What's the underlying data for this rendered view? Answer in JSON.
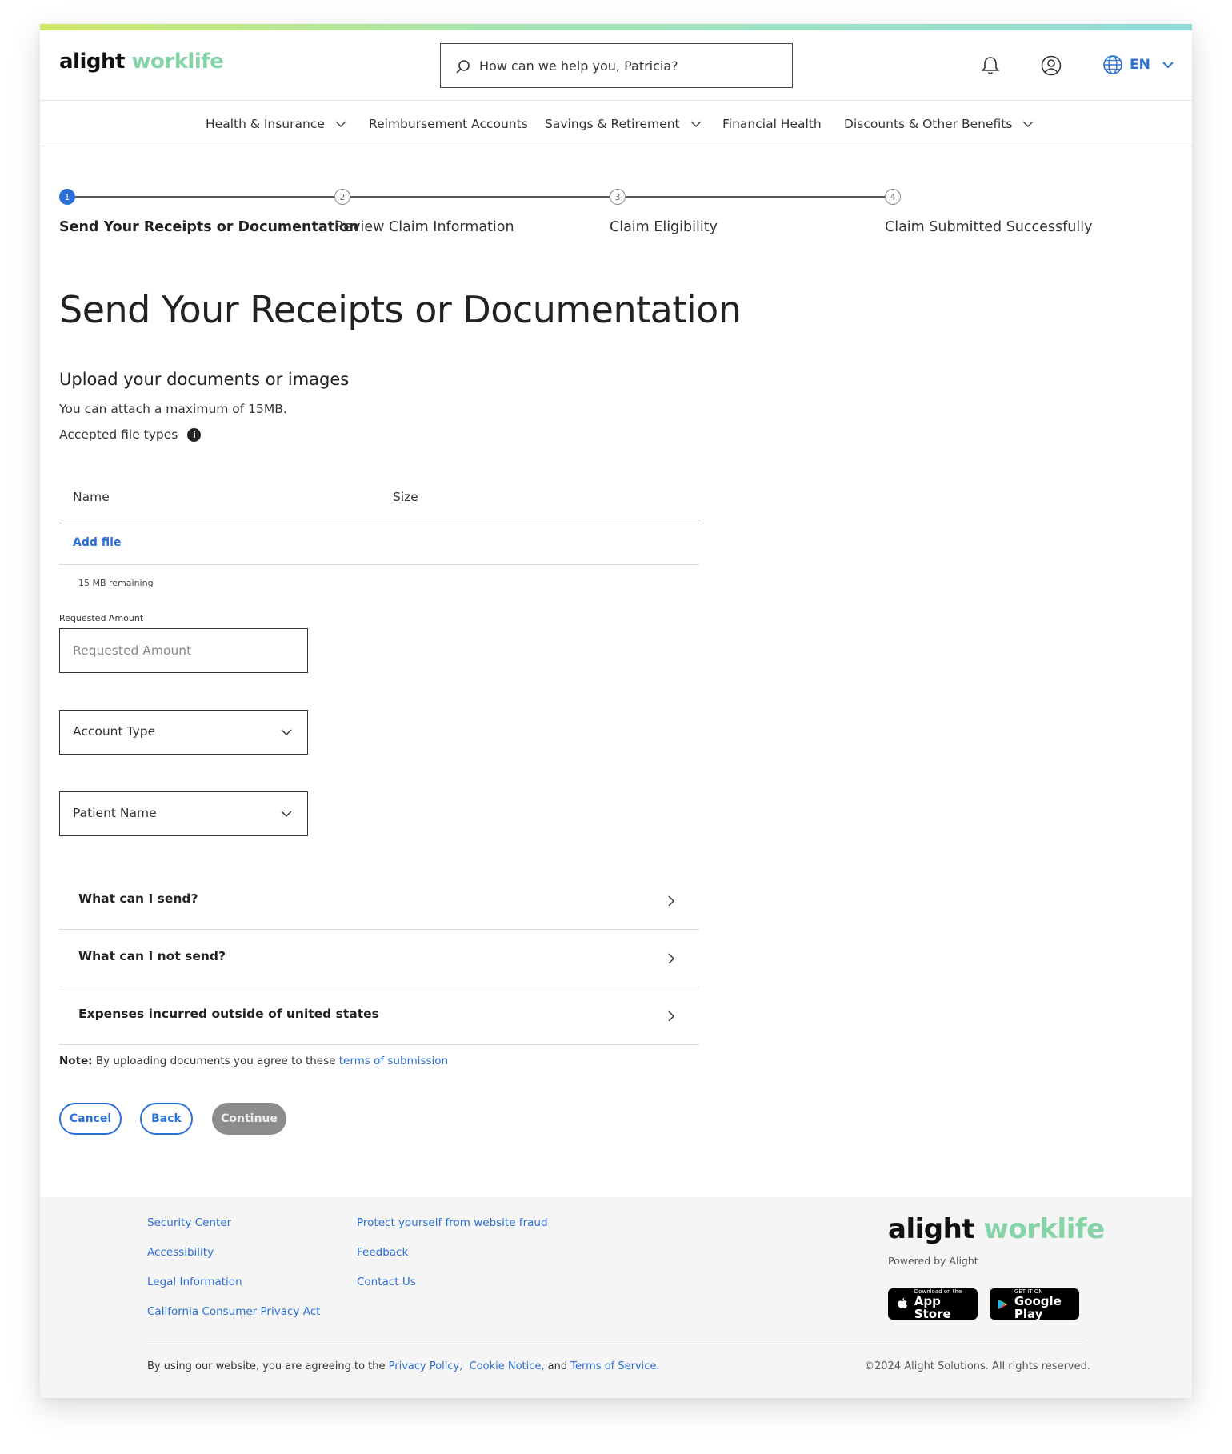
{
  "header": {
    "logo_primary": "alight",
    "logo_secondary": "worklife",
    "search_placeholder": "How can we help you, Patricia?",
    "language": "EN",
    "icons": [
      "search-icon",
      "bell-icon",
      "user-circle-icon",
      "globe-icon",
      "chevron-down-icon"
    ]
  },
  "nav": {
    "items": [
      {
        "label": "Health & Insurance",
        "dropdown": true
      },
      {
        "label": "Reimbursement Accounts",
        "dropdown": false
      },
      {
        "label": "Savings & Retirement",
        "dropdown": true
      },
      {
        "label": "Financial Health",
        "dropdown": false
      },
      {
        "label": "Discounts & Other Benefits",
        "dropdown": true
      }
    ]
  },
  "stepper": {
    "current": 1,
    "steps": [
      {
        "number": "1",
        "label": "Send Your Receipts or Documentation"
      },
      {
        "number": "2",
        "label": "Review Claim Information"
      },
      {
        "number": "3",
        "label": "Claim Eligibility"
      },
      {
        "number": "4",
        "label": "Claim Submitted Successfully"
      }
    ]
  },
  "main": {
    "title": "Send Your Receipts or Documentation",
    "subtitle": "Upload your documents or images",
    "max_size_text": "You can attach a maximum of 15MB.",
    "file_types_label": "Accepted file types",
    "table": {
      "col_name": "Name",
      "col_size": "Size",
      "add_file": "Add file"
    },
    "remaining": "15 MB remaining",
    "requested_amount_label": "Requested Amount",
    "requested_amount_placeholder": "Requested Amount",
    "account_type": "Account Type",
    "patient_name": "Patient Name",
    "accordions": [
      "What can I send?",
      "What can I not send?",
      "Expenses incurred outside of united states"
    ],
    "note_label": "Note:",
    "note_text": " By uploading documents you agree to these ",
    "note_link": "terms of submission",
    "buttons": {
      "cancel": "Cancel",
      "back": "Back",
      "continue": "Continue"
    }
  },
  "footer": {
    "col1": [
      "Security Center",
      "Accessibility",
      "Legal Information",
      "California Consumer Privacy Act"
    ],
    "col2": [
      "Protect yourself from website fraud",
      "Feedback",
      "Contact Us"
    ],
    "logo_primary": "alight",
    "logo_secondary": "worklife",
    "powered_by": "Powered by Alight",
    "app_store_small": "Download on the",
    "app_store_big": "App Store",
    "google_play_small": "GET IT ON",
    "google_play_big": "Google Play",
    "terms_prefix": "By using our website, you are agreeing to the ",
    "privacy_policy": "Privacy Policy,",
    "cookie_notice": "Cookie Notice,",
    "terms_and": " and ",
    "terms_of_service": "Terms of Service.",
    "copyright": "©2024 Alight Solutions. All rights reserved."
  },
  "colors": {
    "accent": "#2b6fd6",
    "logo_green": "#86d3a8",
    "disabled": "#8c8c8c"
  }
}
